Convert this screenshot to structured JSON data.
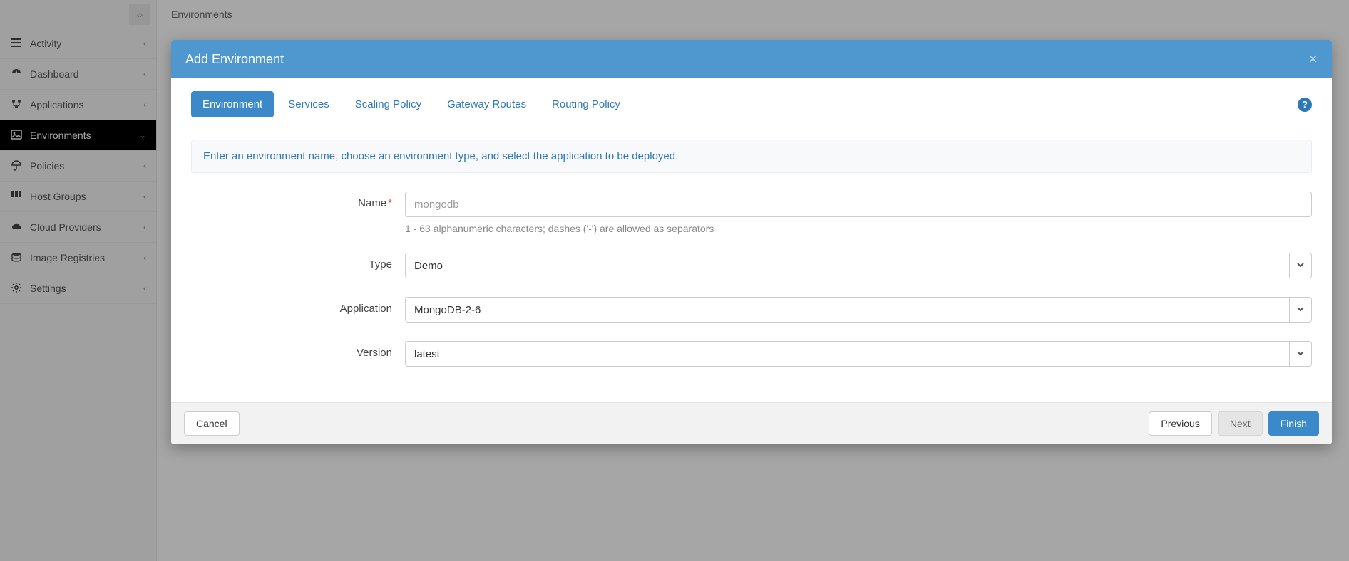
{
  "page": {
    "breadcrumb": "Environments"
  },
  "sidebar": {
    "items": [
      {
        "label": "Activity",
        "icon": "list-icon"
      },
      {
        "label": "Dashboard",
        "icon": "gauge-icon"
      },
      {
        "label": "Applications",
        "icon": "apps-icon"
      },
      {
        "label": "Environments",
        "icon": "image-icon",
        "active": true
      },
      {
        "label": "Policies",
        "icon": "umbrella-icon"
      },
      {
        "label": "Host Groups",
        "icon": "grid-icon"
      },
      {
        "label": "Cloud Providers",
        "icon": "cloud-icon"
      },
      {
        "label": "Image Registries",
        "icon": "stack-icon"
      },
      {
        "label": "Settings",
        "icon": "gear-icon"
      }
    ]
  },
  "modal": {
    "title": "Add Environment",
    "tabs": [
      {
        "label": "Environment",
        "active": true
      },
      {
        "label": "Services"
      },
      {
        "label": "Scaling Policy"
      },
      {
        "label": "Gateway Routes"
      },
      {
        "label": "Routing Policy"
      }
    ],
    "hint": "Enter an environment name, choose an environment type, and select the application to be deployed.",
    "form": {
      "name": {
        "label": "Name",
        "required_mark": "*",
        "placeholder": "mongodb",
        "helper": "1 - 63 alphanumeric characters; dashes ('-') are allowed as separators"
      },
      "type": {
        "label": "Type",
        "value": "Demo"
      },
      "application": {
        "label": "Application",
        "value": "MongoDB-2-6"
      },
      "version": {
        "label": "Version",
        "value": "latest"
      }
    },
    "footer": {
      "cancel": "Cancel",
      "previous": "Previous",
      "next": "Next",
      "finish": "Finish"
    },
    "help_glyph": "?"
  },
  "glyphs": {
    "chevron_left": "‹",
    "chevron_right": "›",
    "chevron_down": "⌄",
    "close": "×"
  }
}
